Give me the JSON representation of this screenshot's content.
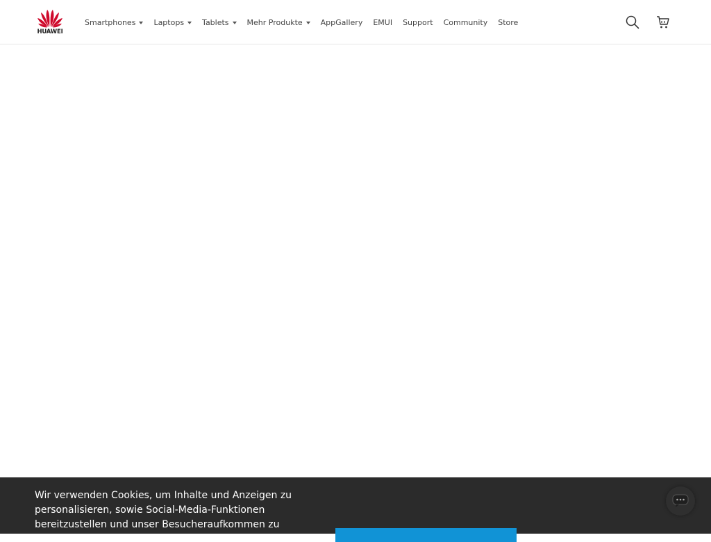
{
  "brand": {
    "logo_text": "HUAWEI",
    "color": "#cf0a2c"
  },
  "nav": {
    "items": [
      {
        "label": "Smartphones",
        "has_dropdown": true
      },
      {
        "label": "Laptops",
        "has_dropdown": true
      },
      {
        "label": "Tablets",
        "has_dropdown": true
      },
      {
        "label": "Mehr Produkte",
        "has_dropdown": true
      },
      {
        "label": "AppGallery",
        "has_dropdown": false
      },
      {
        "label": "EMUI",
        "has_dropdown": false
      },
      {
        "label": "Support",
        "has_dropdown": false
      },
      {
        "label": "Community",
        "has_dropdown": false
      },
      {
        "label": "Store",
        "has_dropdown": false
      }
    ]
  },
  "header_icons": {
    "search": "search-icon",
    "cart": "cart-icon"
  },
  "cookie_banner": {
    "text": "Wir verwenden Cookies, um Inhalte und Anzeigen zu personalisieren, sowie Social-Media-Funktionen bereitzustellen und unser Besucheraufkommen zu",
    "background": "#2b2b2b",
    "button_color": "#1193d6"
  },
  "chat": {
    "icon": "chat-icon"
  }
}
